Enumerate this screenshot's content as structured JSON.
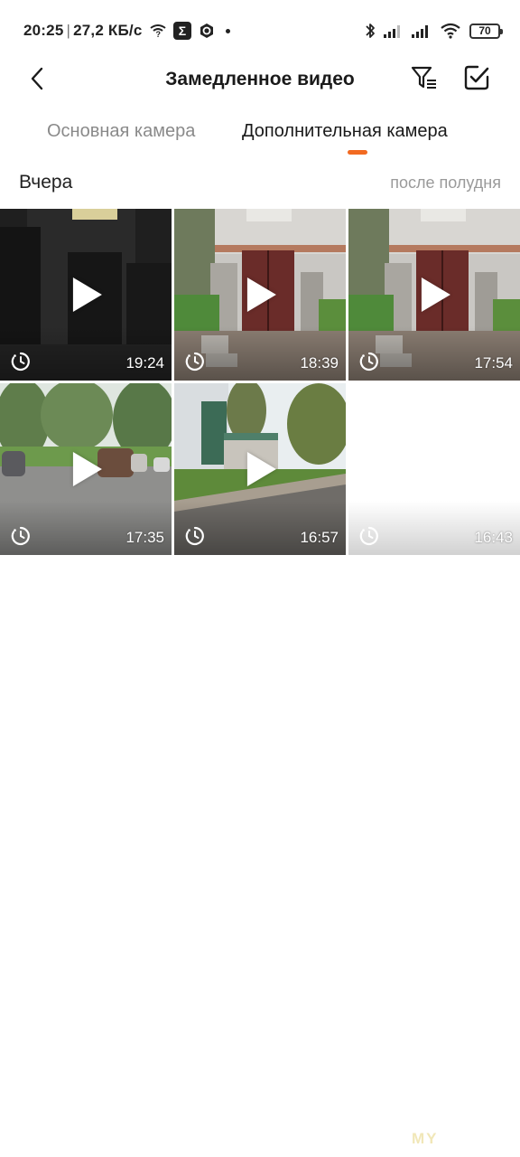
{
  "status_bar": {
    "time": "20:25",
    "net_speed": "27,2 КБ/с",
    "battery": "70",
    "icons_left": [
      "wifi-question-icon",
      "sigma-app-icon",
      "hex-app-icon",
      "dot-icon"
    ],
    "icons_right": [
      "bluetooth-icon",
      "signal-1-icon",
      "signal-2-icon",
      "wifi-icon",
      "battery-icon"
    ]
  },
  "header": {
    "title": "Замедленное видео",
    "back_icon": "chevron-left-icon",
    "filter_icon": "filter-icon",
    "select_icon": "checkbox-icon"
  },
  "tabs": [
    {
      "label": "Основная камера",
      "active": false
    },
    {
      "label": "Дополнительная камера",
      "active": true
    }
  ],
  "accent_color": "#f26a21",
  "section": {
    "date": "Вчера",
    "period": "после полудня"
  },
  "videos": [
    {
      "time": "19:24",
      "scene": "night-garage"
    },
    {
      "time": "18:39",
      "scene": "day-garage"
    },
    {
      "time": "17:54",
      "scene": "day-garage"
    },
    {
      "time": "17:35",
      "scene": "street-cars"
    },
    {
      "time": "16:57",
      "scene": "street-road"
    },
    {
      "time": "16:43",
      "scene": "blank"
    }
  ],
  "watermark": "MY"
}
